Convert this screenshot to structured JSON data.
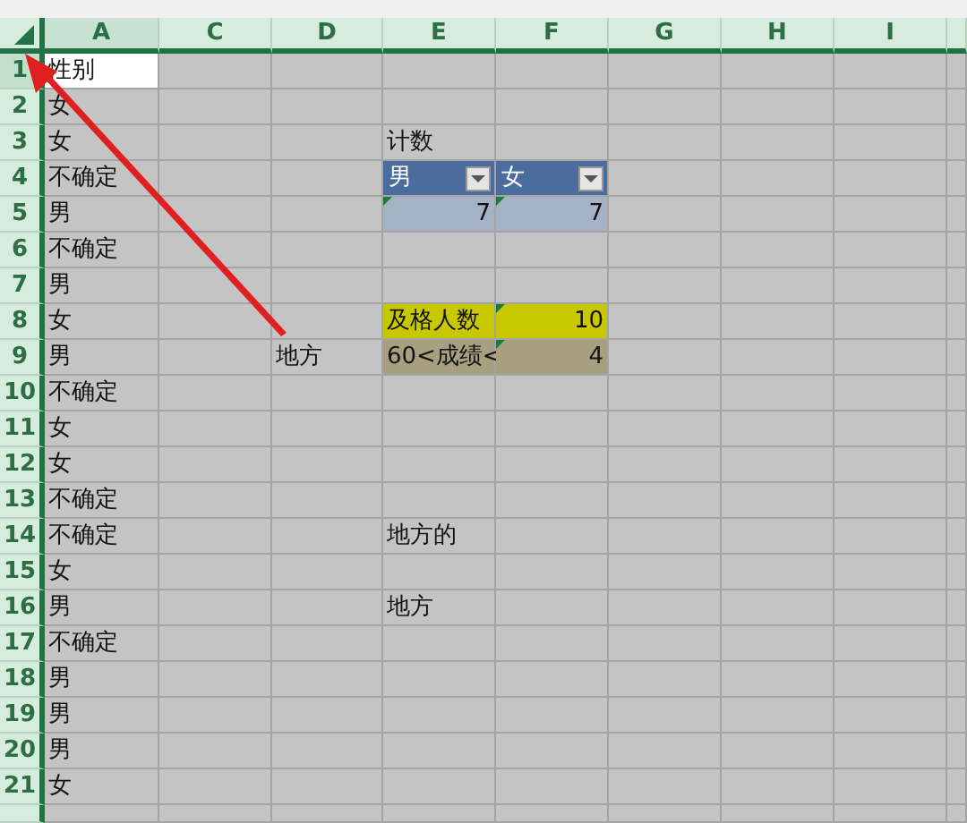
{
  "columns": [
    {
      "label": "A",
      "selected": true
    },
    {
      "label": "C",
      "selected": false
    },
    {
      "label": "D",
      "selected": false
    },
    {
      "label": "E",
      "selected": false
    },
    {
      "label": "F",
      "selected": false
    },
    {
      "label": "G",
      "selected": false
    },
    {
      "label": "H",
      "selected": false
    },
    {
      "label": "I",
      "selected": false
    }
  ],
  "rows": [
    {
      "number": "1",
      "selected": true,
      "cells": [
        {
          "text": "性别",
          "kind": "text",
          "selected": true,
          "error_mark": false
        }
      ]
    },
    {
      "number": "2",
      "selected": false,
      "cells": [
        {
          "text": "女",
          "kind": "text",
          "selected": false,
          "error_mark": false
        }
      ]
    },
    {
      "number": "3",
      "selected": false,
      "cells": [
        {
          "text": "女",
          "kind": "text",
          "selected": false,
          "error_mark": false
        },
        null,
        null,
        {
          "text": "计数",
          "kind": "text",
          "selected": false,
          "error_mark": false
        }
      ]
    },
    {
      "number": "4",
      "selected": false,
      "cells": [
        {
          "text": "不确定",
          "kind": "text",
          "selected": false,
          "error_mark": false
        },
        null,
        null,
        {
          "text": "男",
          "kind": "pivot-header",
          "selected": false,
          "error_mark": false
        },
        {
          "text": "女",
          "kind": "pivot-header",
          "selected": false,
          "error_mark": false
        }
      ]
    },
    {
      "number": "5",
      "selected": false,
      "cells": [
        {
          "text": "男",
          "kind": "text",
          "selected": false,
          "error_mark": false
        },
        null,
        null,
        {
          "text": "7",
          "kind": "pivot-value",
          "selected": false,
          "error_mark": true
        },
        {
          "text": "7",
          "kind": "pivot-value",
          "selected": false,
          "error_mark": true
        }
      ]
    },
    {
      "number": "6",
      "selected": false,
      "cells": [
        {
          "text": "不确定",
          "kind": "text",
          "selected": false,
          "error_mark": false
        }
      ]
    },
    {
      "number": "7",
      "selected": false,
      "cells": [
        {
          "text": "男",
          "kind": "text",
          "selected": false,
          "error_mark": false
        }
      ]
    },
    {
      "number": "8",
      "selected": false,
      "cells": [
        {
          "text": "女",
          "kind": "text",
          "selected": false,
          "error_mark": false
        },
        null,
        null,
        {
          "text": "及格人数",
          "kind": "text",
          "selected": false,
          "error_mark": false,
          "color": "#c8c800"
        },
        {
          "text": "10",
          "kind": "number",
          "selected": false,
          "error_mark": true,
          "color": "#c8c800"
        }
      ]
    },
    {
      "number": "9",
      "selected": false,
      "cells": [
        {
          "text": "男",
          "kind": "text",
          "selected": false,
          "error_mark": false
        },
        null,
        {
          "text": "地方",
          "kind": "text",
          "selected": false,
          "error_mark": false
        },
        {
          "text": "60<成绩<",
          "kind": "text",
          "selected": false,
          "error_mark": false,
          "color": "#a89f80"
        },
        {
          "text": "4",
          "kind": "number",
          "selected": false,
          "error_mark": true,
          "color": "#a89f80"
        }
      ]
    },
    {
      "number": "10",
      "selected": false,
      "cells": [
        {
          "text": "不确定",
          "kind": "text",
          "selected": false,
          "error_mark": false
        }
      ]
    },
    {
      "number": "11",
      "selected": false,
      "cells": [
        {
          "text": "女",
          "kind": "text",
          "selected": false,
          "error_mark": false
        }
      ]
    },
    {
      "number": "12",
      "selected": false,
      "cells": [
        {
          "text": "女",
          "kind": "text",
          "selected": false,
          "error_mark": false
        }
      ]
    },
    {
      "number": "13",
      "selected": false,
      "cells": [
        {
          "text": "不确定",
          "kind": "text",
          "selected": false,
          "error_mark": false
        }
      ]
    },
    {
      "number": "14",
      "selected": false,
      "cells": [
        {
          "text": "不确定",
          "kind": "text",
          "selected": false,
          "error_mark": false
        },
        null,
        null,
        {
          "text": "地方的",
          "kind": "text",
          "selected": false,
          "error_mark": false
        }
      ]
    },
    {
      "number": "15",
      "selected": false,
      "cells": [
        {
          "text": "女",
          "kind": "text",
          "selected": false,
          "error_mark": false
        }
      ]
    },
    {
      "number": "16",
      "selected": false,
      "cells": [
        {
          "text": "男",
          "kind": "text",
          "selected": false,
          "error_mark": false
        },
        null,
        null,
        {
          "text": "地方",
          "kind": "text",
          "selected": false,
          "error_mark": false
        }
      ]
    },
    {
      "number": "17",
      "selected": false,
      "cells": [
        {
          "text": "不确定",
          "kind": "text",
          "selected": false,
          "error_mark": false
        }
      ]
    },
    {
      "number": "18",
      "selected": false,
      "cells": [
        {
          "text": "男",
          "kind": "text",
          "selected": false,
          "error_mark": false
        }
      ]
    },
    {
      "number": "19",
      "selected": false,
      "cells": [
        {
          "text": "男",
          "kind": "text",
          "selected": false,
          "error_mark": false
        }
      ]
    },
    {
      "number": "20",
      "selected": false,
      "cells": [
        {
          "text": "男",
          "kind": "text",
          "selected": false,
          "error_mark": false
        }
      ]
    },
    {
      "number": "21",
      "selected": false,
      "cells": [
        {
          "text": "女",
          "kind": "text",
          "selected": false,
          "error_mark": false
        }
      ]
    }
  ]
}
